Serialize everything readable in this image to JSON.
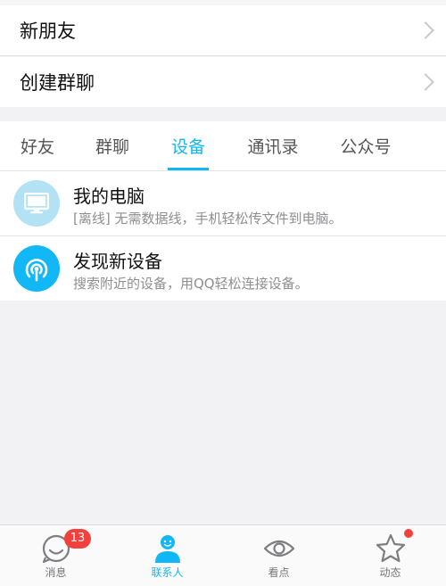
{
  "menu": {
    "new_friends": "新朋友",
    "create_group": "创建群聊"
  },
  "tabs": [
    {
      "label": "好友",
      "active": false
    },
    {
      "label": "群聊",
      "active": false
    },
    {
      "label": "设备",
      "active": true
    },
    {
      "label": "通讯录",
      "active": false
    },
    {
      "label": "公众号",
      "active": false
    }
  ],
  "devices": [
    {
      "title": "我的电脑",
      "subtitle": "[离线] 无需数据线，手机轻松传文件到电脑。",
      "icon": "monitor-icon"
    },
    {
      "title": "发现新设备",
      "subtitle": "搜索附近的设备，用QQ轻松连接设备。",
      "icon": "radar-icon"
    }
  ],
  "bottom_nav": [
    {
      "label": "消息",
      "icon": "message-smile-icon",
      "badge": "13",
      "active": false
    },
    {
      "label": "联系人",
      "icon": "contacts-person-icon",
      "active": true
    },
    {
      "label": "看点",
      "icon": "eye-icon",
      "active": false
    },
    {
      "label": "动态",
      "icon": "star-icon",
      "dot": true,
      "active": false
    }
  ],
  "colors": {
    "accent": "#12b7f5",
    "badge": "#f2413c",
    "background": "#f2f2f4"
  }
}
